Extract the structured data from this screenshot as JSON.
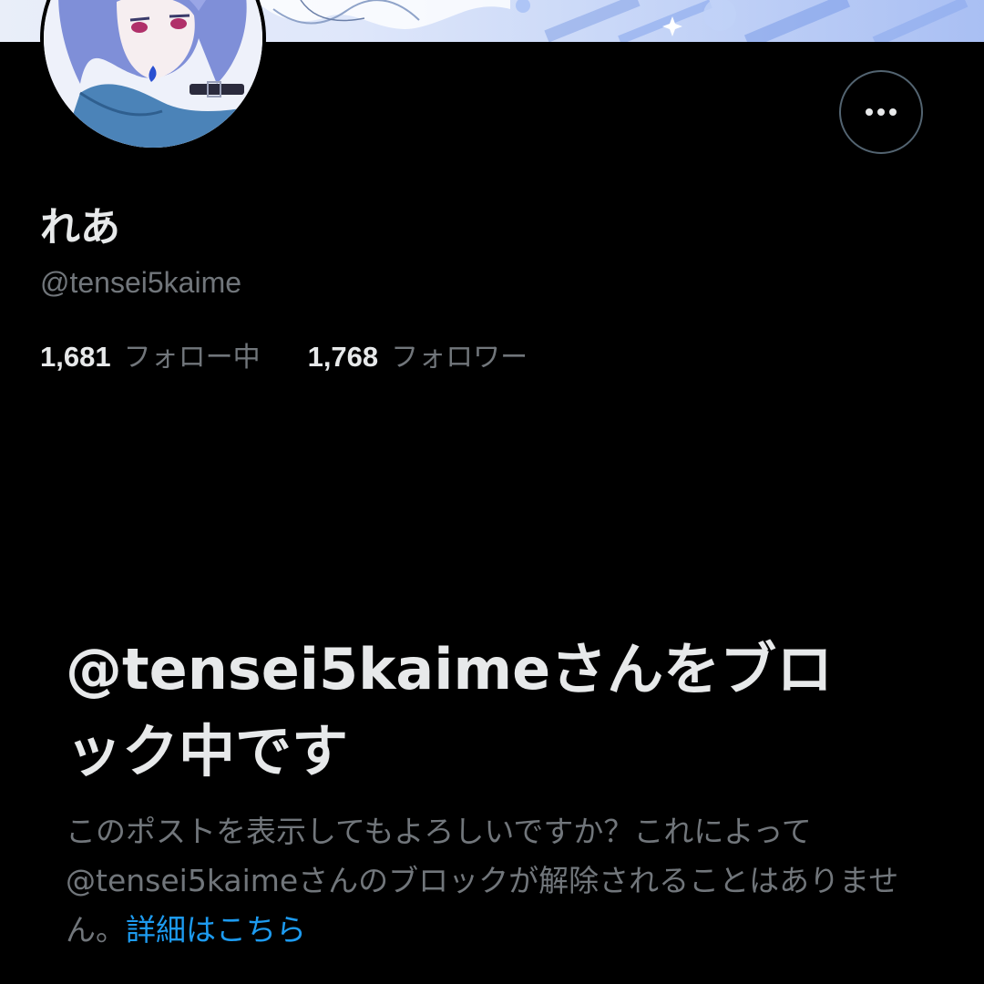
{
  "profile": {
    "display_name": "れあ",
    "handle": "@tensei5kaime",
    "more_icon": "more-horizontal-icon"
  },
  "stats": {
    "following_count": "1,681",
    "following_label": "フォロー中",
    "followers_count": "1,768",
    "followers_label": "フォロワー"
  },
  "blocked_notice": {
    "title": "@tensei5kaimeさんをブロック中です",
    "description": "このポストを表示してもよろしいですか？これによって@tensei5kaimeさんのブロックが解除されることはありません。",
    "link_label": "詳細はこちら"
  },
  "colors": {
    "background": "#000000",
    "primary_text": "#e7e9ea",
    "secondary_text": "#71767b",
    "link": "#1d9bf0",
    "border": "#536471"
  }
}
